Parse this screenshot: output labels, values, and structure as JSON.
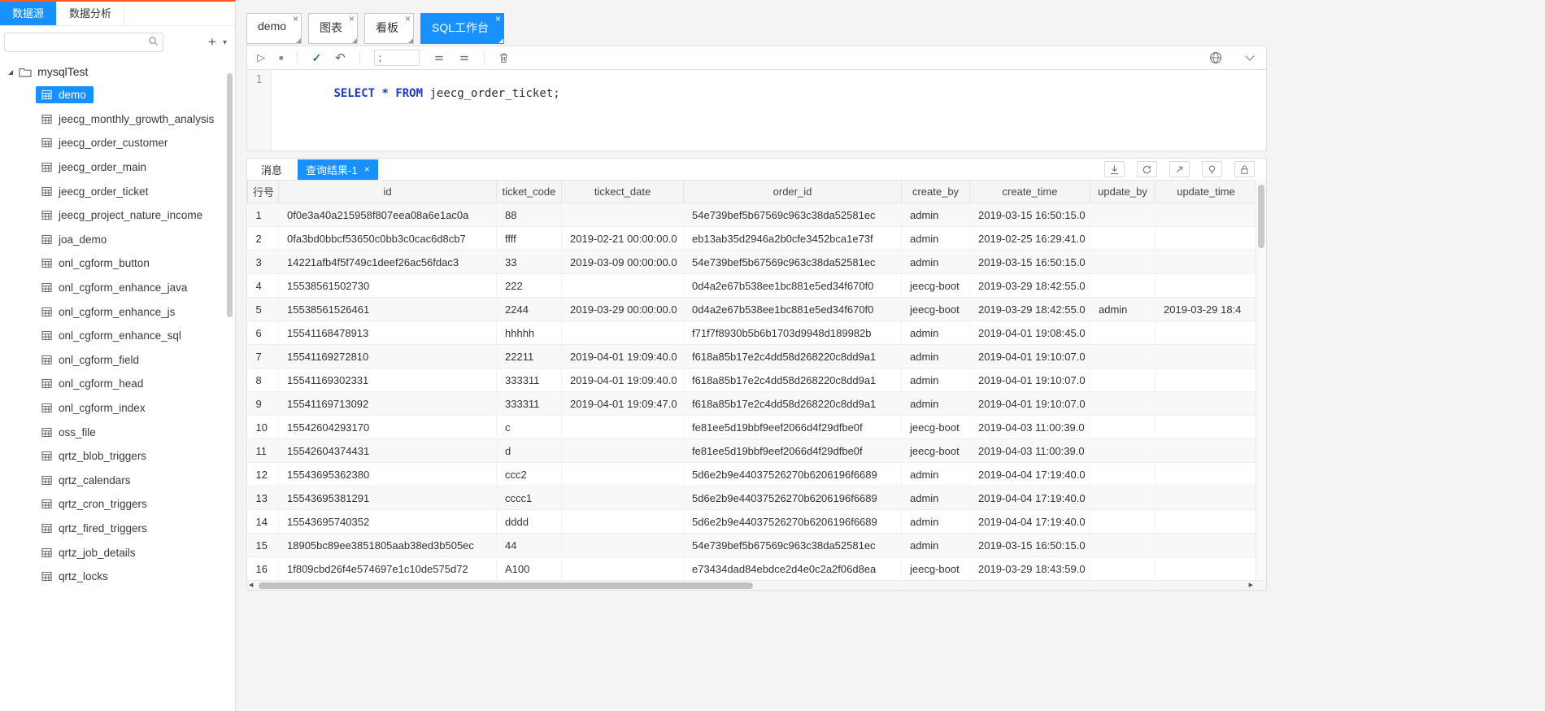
{
  "colors": {
    "accent": "#1890ff",
    "top_line": "#ff5a1e",
    "keyword": "#1d39c4"
  },
  "ui": {
    "close_glyph": "×",
    "icons": {
      "run": "▷",
      "stop": "■",
      "check": "✓",
      "undo": "↶",
      "plus": "+",
      "caret_down": "▾",
      "tree_caret": "◢",
      "scroll_left": "◀",
      "scroll_right": "▶"
    }
  },
  "sidebar": {
    "tabs": [
      {
        "label": "数据源",
        "active": true
      },
      {
        "label": "数据分析",
        "active": false
      }
    ],
    "search": {
      "value": "",
      "placeholder": ""
    },
    "tree": {
      "root_label": "mysqlTest",
      "items": [
        {
          "label": "demo",
          "selected": true
        },
        {
          "label": "jeecg_monthly_growth_analysis"
        },
        {
          "label": "jeecg_order_customer"
        },
        {
          "label": "jeecg_order_main"
        },
        {
          "label": "jeecg_order_ticket"
        },
        {
          "label": "jeecg_project_nature_income"
        },
        {
          "label": "joa_demo"
        },
        {
          "label": "onl_cgform_button"
        },
        {
          "label": "onl_cgform_enhance_java"
        },
        {
          "label": "onl_cgform_enhance_js"
        },
        {
          "label": "onl_cgform_enhance_sql"
        },
        {
          "label": "onl_cgform_field"
        },
        {
          "label": "onl_cgform_head"
        },
        {
          "label": "onl_cgform_index"
        },
        {
          "label": "oss_file"
        },
        {
          "label": "qrtz_blob_triggers"
        },
        {
          "label": "qrtz_calendars"
        },
        {
          "label": "qrtz_cron_triggers"
        },
        {
          "label": "qrtz_fired_triggers"
        },
        {
          "label": "qrtz_job_details"
        },
        {
          "label": "qrtz_locks"
        }
      ]
    }
  },
  "workspace": {
    "tabs": [
      {
        "label": "demo",
        "active": false
      },
      {
        "label": "图表",
        "active": false
      },
      {
        "label": "看板",
        "active": false
      },
      {
        "label": "SQL工作台",
        "active": true
      }
    ],
    "toolbar": {
      "delimiter_value": ";"
    },
    "editor": {
      "line_number": "1",
      "code": [
        {
          "text": "SELECT",
          "type": "keyword"
        },
        {
          "text": " ",
          "type": "plain"
        },
        {
          "text": "*",
          "type": "keyword"
        },
        {
          "text": " ",
          "type": "plain"
        },
        {
          "text": "FROM",
          "type": "keyword"
        },
        {
          "text": " jeecg_order_ticket;",
          "type": "plain"
        }
      ]
    }
  },
  "results": {
    "tabs": [
      {
        "label": "消息",
        "active": false,
        "closable": false
      },
      {
        "label": "查询结果-1",
        "active": true,
        "closable": true
      }
    ],
    "table": {
      "columns": [
        "行号",
        "id",
        "ticket_code",
        "tickect_date",
        "order_id",
        "create_by",
        "create_time",
        "update_by",
        "update_time"
      ],
      "rows": [
        [
          "1",
          "0f0e3a40a215958f807eea08a6e1ac0a",
          "88",
          "",
          "54e739bef5b67569c963c38da52581ec",
          "admin",
          "2019-03-15 16:50:15.0",
          "",
          ""
        ],
        [
          "2",
          "0fa3bd0bbcf53650c0bb3c0cac6d8cb7",
          "ffff",
          "2019-02-21 00:00:00.0",
          "eb13ab35d2946a2b0cfe3452bca1e73f",
          "admin",
          "2019-02-25 16:29:41.0",
          "",
          ""
        ],
        [
          "3",
          "14221afb4f5f749c1deef26ac56fdac3",
          "33",
          "2019-03-09 00:00:00.0",
          "54e739bef5b67569c963c38da52581ec",
          "admin",
          "2019-03-15 16:50:15.0",
          "",
          ""
        ],
        [
          "4",
          "15538561502730",
          "222",
          "",
          "0d4a2e67b538ee1bc881e5ed34f670f0",
          "jeecg-boot",
          "2019-03-29 18:42:55.0",
          "",
          ""
        ],
        [
          "5",
          "15538561526461",
          "2244",
          "2019-03-29 00:00:00.0",
          "0d4a2e67b538ee1bc881e5ed34f670f0",
          "jeecg-boot",
          "2019-03-29 18:42:55.0",
          "admin",
          "2019-03-29 18:4"
        ],
        [
          "6",
          "15541168478913",
          "hhhhh",
          "",
          "f71f7f8930b5b6b1703d9948d189982b",
          "admin",
          "2019-04-01 19:08:45.0",
          "",
          ""
        ],
        [
          "7",
          "15541169272810",
          "22211",
          "2019-04-01 19:09:40.0",
          "f618a85b17e2c4dd58d268220c8dd9a1",
          "admin",
          "2019-04-01 19:10:07.0",
          "",
          ""
        ],
        [
          "8",
          "15541169302331",
          "333311",
          "2019-04-01 19:09:40.0",
          "f618a85b17e2c4dd58d268220c8dd9a1",
          "admin",
          "2019-04-01 19:10:07.0",
          "",
          ""
        ],
        [
          "9",
          "15541169713092",
          "333311",
          "2019-04-01 19:09:47.0",
          "f618a85b17e2c4dd58d268220c8dd9a1",
          "admin",
          "2019-04-01 19:10:07.0",
          "",
          ""
        ],
        [
          "10",
          "15542604293170",
          "c",
          "",
          "fe81ee5d19bbf9eef2066d4f29dfbe0f",
          "jeecg-boot",
          "2019-04-03 11:00:39.0",
          "",
          ""
        ],
        [
          "11",
          "15542604374431",
          "d",
          "",
          "fe81ee5d19bbf9eef2066d4f29dfbe0f",
          "jeecg-boot",
          "2019-04-03 11:00:39.0",
          "",
          ""
        ],
        [
          "12",
          "15543695362380",
          "ccc2",
          "",
          "5d6e2b9e44037526270b6206196f6689",
          "admin",
          "2019-04-04 17:19:40.0",
          "",
          ""
        ],
        [
          "13",
          "15543695381291",
          "cccc1",
          "",
          "5d6e2b9e44037526270b6206196f6689",
          "admin",
          "2019-04-04 17:19:40.0",
          "",
          ""
        ],
        [
          "14",
          "15543695740352",
          "dddd",
          "",
          "5d6e2b9e44037526270b6206196f6689",
          "admin",
          "2019-04-04 17:19:40.0",
          "",
          ""
        ],
        [
          "15",
          "18905bc89ee3851805aab38ed3b505ec",
          "44",
          "",
          "54e739bef5b67569c963c38da52581ec",
          "admin",
          "2019-03-15 16:50:15.0",
          "",
          ""
        ],
        [
          "16",
          "1f809cbd26f4e574697e1c10de575d72",
          "A100",
          "",
          "e73434dad84ebdce2d4e0c2a2f06d8ea",
          "jeecg-boot",
          "2019-03-29 18:43:59.0",
          "",
          ""
        ]
      ]
    }
  }
}
